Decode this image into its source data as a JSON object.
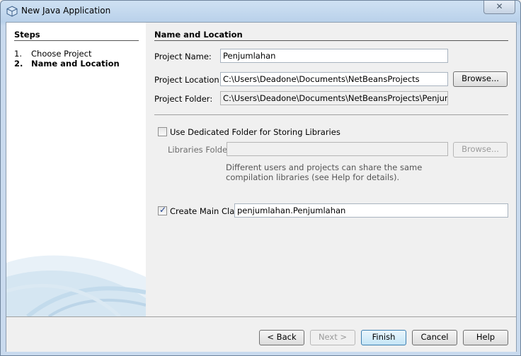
{
  "window": {
    "title": "New Java Application",
    "close_glyph": "✕"
  },
  "steps": {
    "title": "Steps",
    "items": [
      {
        "num": "1.",
        "label": "Choose Project",
        "active": false
      },
      {
        "num": "2.",
        "label": "Name and Location",
        "active": true
      }
    ]
  },
  "section": {
    "title": "Name and Location"
  },
  "form": {
    "project_name": {
      "label": "Project Name:",
      "value": "Penjumlahan"
    },
    "project_location": {
      "label": "Project Location:",
      "value": "C:\\Users\\Deadone\\Documents\\NetBeansProjects",
      "browse": "Browse..."
    },
    "project_folder": {
      "label": "Project Folder:",
      "value": "C:\\Users\\Deadone\\Documents\\NetBeansProjects\\Penjumlahan"
    },
    "dedicated_folder": {
      "label": "Use Dedicated Folder for Storing Libraries",
      "checked": false
    },
    "libraries_folder": {
      "label": "Libraries Folder:",
      "value": "",
      "browse": "Browse..."
    },
    "hint": "Different users and projects can share the same compilation libraries (see Help for details).",
    "main_class": {
      "label": "Create Main Class",
      "checked": true,
      "value": "penjumlahan.Penjumlahan"
    }
  },
  "buttons": {
    "back": "< Back",
    "next": "Next >",
    "finish": "Finish",
    "cancel": "Cancel",
    "help": "Help"
  },
  "icons": {
    "app": "netbeans-cube-icon",
    "close": "close-icon",
    "check": "checkmark-icon"
  }
}
